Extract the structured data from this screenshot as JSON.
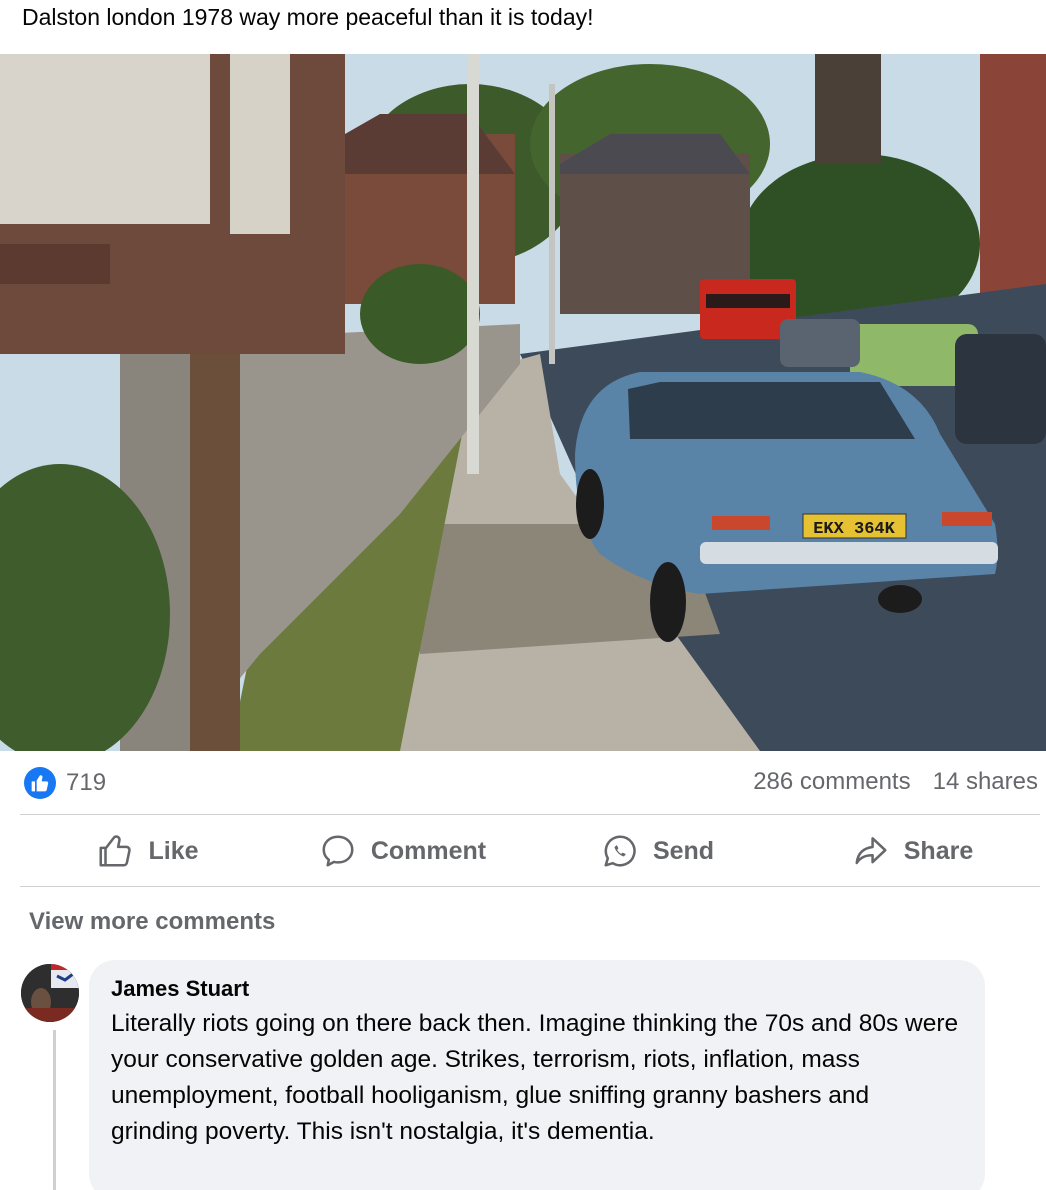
{
  "post": {
    "text": "Dalston london 1978 way more peaceful than it is today!"
  },
  "photo": {
    "plate_text": "EKX 364K"
  },
  "engagement": {
    "likes": "719",
    "comments": "286 comments",
    "shares": "14 shares"
  },
  "actions": {
    "like": "Like",
    "comment": "Comment",
    "send": "Send",
    "share": "Share"
  },
  "comments_section": {
    "view_more": "View more comments",
    "items": [
      {
        "author": "James Stuart",
        "text": "Literally riots going on there back then. Imagine thinking the 70s and 80s were your conservative golden age. Strikes, terrorism, riots, inflation, mass unemployment, football hooliganism, glue sniffing granny bashers and grinding poverty. This isn't nostalgia, it's dementia."
      }
    ]
  },
  "colors": {
    "brand_blue": "#1877f2",
    "muted_text": "#65676b",
    "bubble_bg": "#f0f2f5"
  },
  "icons": {
    "reaction": "thumbs-up-icon",
    "like": "thumbs-up-outline-icon",
    "comment": "speech-bubble-icon",
    "send": "messenger-icon",
    "share": "share-arrow-icon"
  }
}
